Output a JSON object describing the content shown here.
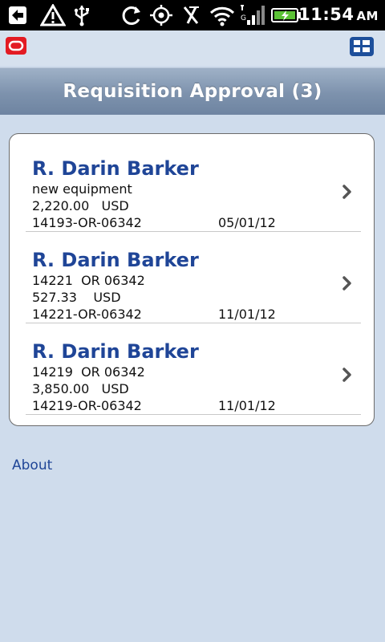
{
  "status_bar": {
    "time": "11:54",
    "ampm": "AM",
    "icons": [
      "back-arrow-icon",
      "warning-icon",
      "usb-icon",
      "sync-icon",
      "gps-icon",
      "vibrate-off-icon",
      "wifi-icon",
      "signal-icon",
      "battery-charging-icon"
    ]
  },
  "app_bar": {
    "logo_icon": "oracle-logo-icon",
    "menu_icon": "grid-menu-icon"
  },
  "header": {
    "title": "Requisition Approval (3)"
  },
  "requisitions": [
    {
      "name": "R. Darin Barker",
      "description": "new equipment",
      "amount": "2,220.00   USD",
      "number": "14193-OR-06342",
      "date": "05/01/12"
    },
    {
      "name": "R. Darin Barker",
      "description": "14221  OR 06342",
      "amount": "527.33    USD",
      "number": "14221-OR-06342",
      "date": "11/01/12"
    },
    {
      "name": "R. Darin Barker",
      "description": "14219  OR 06342",
      "amount": "3,850.00   USD",
      "number": "14219-OR-06342",
      "date": "11/01/12"
    }
  ],
  "footer": {
    "about_label": "About"
  },
  "colors": {
    "background": "#cfdcec",
    "name_text": "#1f4597",
    "title_bar": "#7d92ad"
  }
}
